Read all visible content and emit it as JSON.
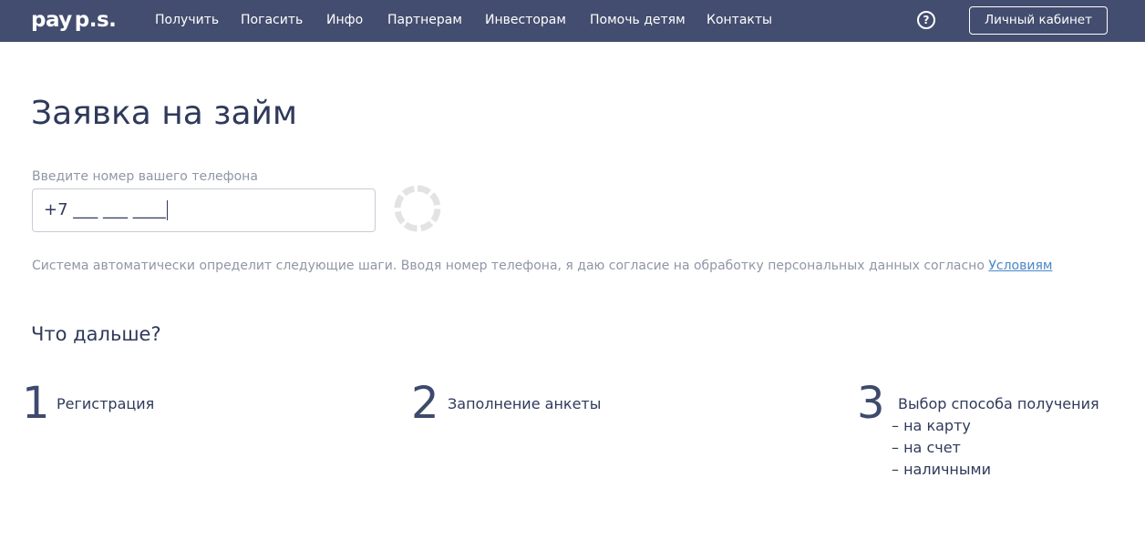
{
  "header": {
    "logo_pay": "pay",
    "logo_ps": "p.s.",
    "nav": [
      "Получить",
      "Погасить",
      "Инфо",
      "Партнерам",
      "Инвесторам",
      "Помочь детям",
      "Контакты"
    ],
    "help_label": "?",
    "cabinet_label": "Личный кабинет"
  },
  "main": {
    "title": "Заявка на займ",
    "phone_label": "Введите номер вашего телефона",
    "phone_value": "+7 ___ ___ ____",
    "consent_text": "Система автоматически определит следующие шаги. Вводя номер телефона, я даю согласие на обработку персональных данных согласно ",
    "consent_link": "Условиям",
    "next_title": "Что дальше?",
    "steps": [
      {
        "number": "1",
        "label": "Регистрация"
      },
      {
        "number": "2",
        "label": "Заполнение анкеты"
      },
      {
        "number": "3",
        "label": "Выбор способа получения",
        "options": [
          "– на карту",
          "– на счет",
          "– наличными"
        ]
      }
    ]
  },
  "colors": {
    "header_bg": "#434d6f",
    "text_primary": "#2f3a5a",
    "text_muted": "#8f96a6",
    "link": "#4a86c8"
  },
  "icons": {
    "help": "question-circle-icon",
    "spinner": "loading-spinner-icon"
  }
}
